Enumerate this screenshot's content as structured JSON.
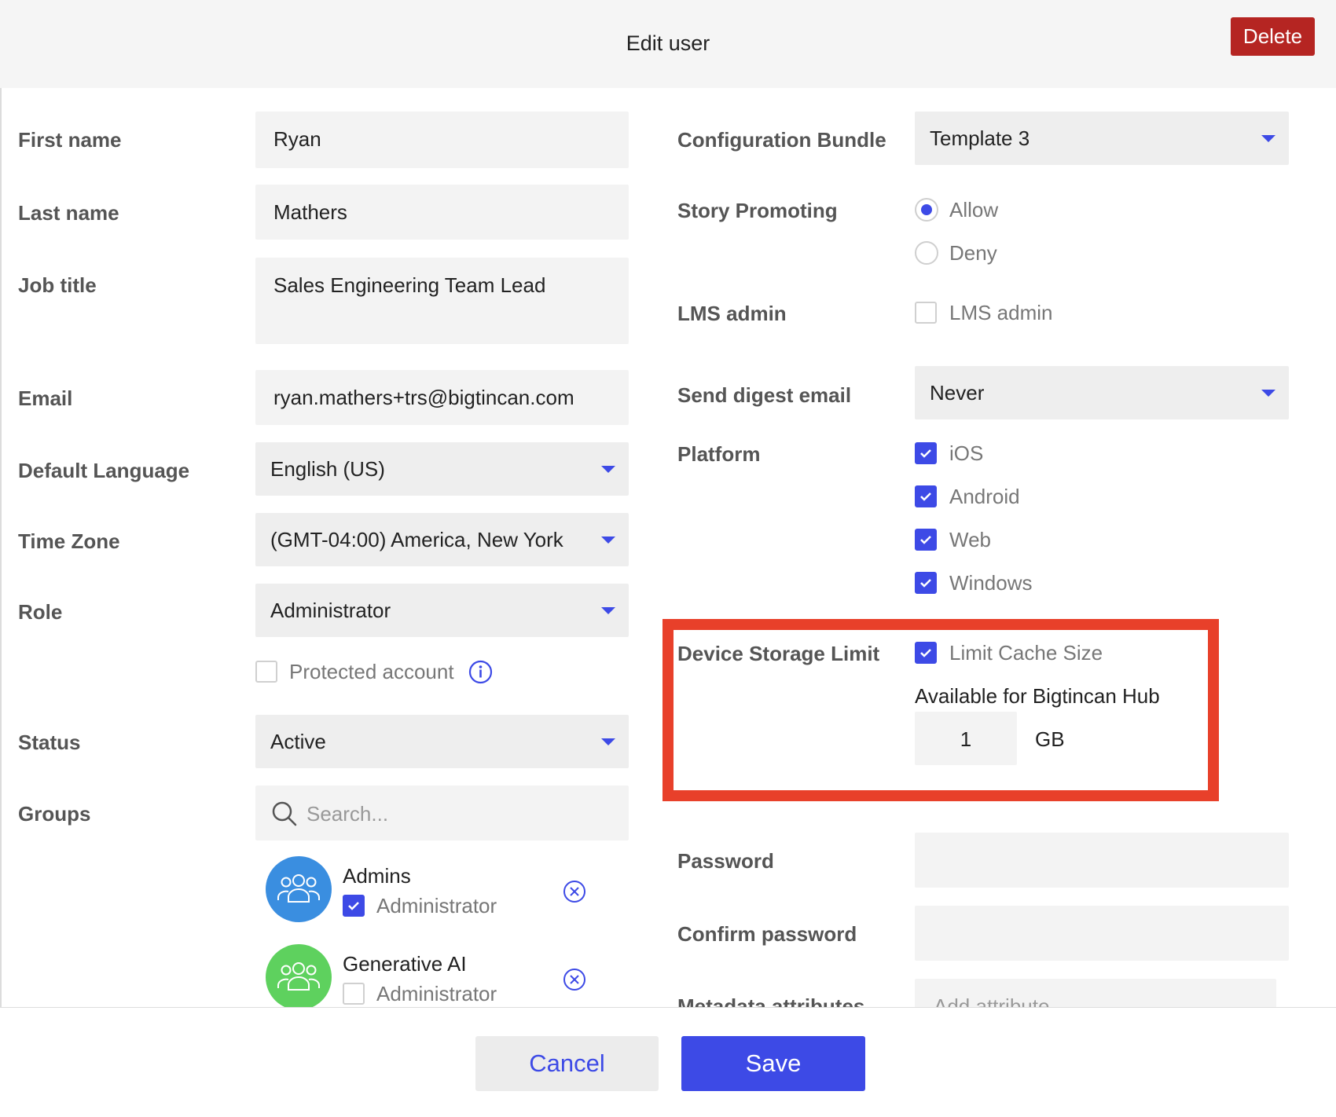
{
  "header": {
    "title": "Edit user",
    "delete_label": "Delete"
  },
  "left": {
    "first_name": {
      "label": "First name",
      "value": "Ryan"
    },
    "last_name": {
      "label": "Last name",
      "value": "Mathers"
    },
    "job_title": {
      "label": "Job title",
      "value": "Sales Engineering Team Lead"
    },
    "email": {
      "label": "Email",
      "value": "ryan.mathers+trs@bigtincan.com"
    },
    "default_language": {
      "label": "Default Language",
      "value": "English (US)"
    },
    "time_zone": {
      "label": "Time Zone",
      "value": "(GMT-04:00) America, New York"
    },
    "role": {
      "label": "Role",
      "value": "Administrator"
    },
    "protected_account": {
      "label": "Protected account",
      "checked": false
    },
    "status": {
      "label": "Status",
      "value": "Active"
    },
    "groups": {
      "label": "Groups",
      "search_placeholder": "Search...",
      "items": [
        {
          "name": "Admins",
          "role_label": "Administrator",
          "checked": true,
          "color": "#3a8ee0"
        },
        {
          "name": "Generative AI",
          "role_label": "Administrator",
          "checked": false,
          "color": "#5ed15e"
        }
      ]
    }
  },
  "right": {
    "configuration_bundle": {
      "label": "Configuration Bundle",
      "value": "Template 3"
    },
    "story_promoting": {
      "label": "Story Promoting",
      "options": [
        "Allow",
        "Deny"
      ],
      "selected": "Allow"
    },
    "lms_admin": {
      "label": "LMS admin",
      "option_label": "LMS admin",
      "checked": false
    },
    "send_digest_email": {
      "label": "Send digest email",
      "value": "Never"
    },
    "platform": {
      "label": "Platform",
      "options": [
        {
          "label": "iOS",
          "checked": true
        },
        {
          "label": "Android",
          "checked": true
        },
        {
          "label": "Web",
          "checked": true
        },
        {
          "label": "Windows",
          "checked": true
        }
      ]
    },
    "device_storage_limit": {
      "label": "Device Storage Limit",
      "option_label": "Limit Cache Size",
      "checked": true,
      "available_text": "Available for Bigtincan Hub",
      "size_value": "1",
      "unit": "GB"
    },
    "password": {
      "label": "Password"
    },
    "confirm_password": {
      "label": "Confirm password"
    },
    "metadata_attributes": {
      "label": "Metadata attributes",
      "placeholder": "Add attribute"
    }
  },
  "footer": {
    "cancel_label": "Cancel",
    "save_label": "Save"
  },
  "colors": {
    "accent": "#3d4ae6",
    "danger": "#b52522",
    "highlight": "#e8402a"
  }
}
